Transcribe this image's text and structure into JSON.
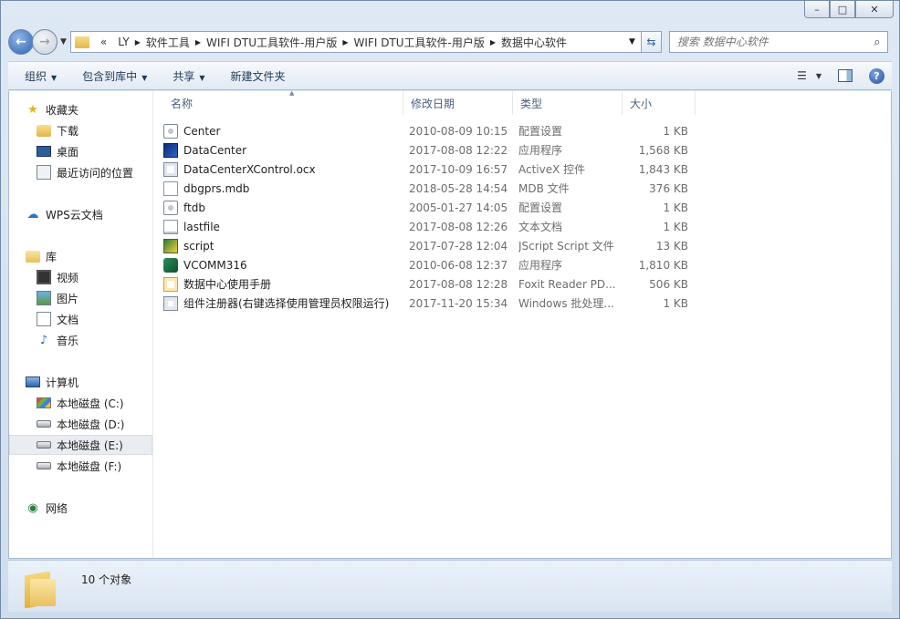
{
  "window": {
    "minimize_icon": "minimize-icon",
    "maximize_icon": "maximize-icon",
    "close_icon": "close-icon"
  },
  "address_bar": {
    "overflow": "«",
    "crumbs": [
      "LY",
      "软件工具",
      "WIFI DTU工具软件-用户版",
      "WIFI DTU工具软件-用户版",
      "数据中心软件"
    ]
  },
  "search": {
    "placeholder": "搜索 数据中心软件"
  },
  "toolbar": {
    "organize": "组织",
    "include_in_library": "包含到库中",
    "share": "共享",
    "new_folder": "新建文件夹"
  },
  "nav": {
    "favorites": "收藏夹",
    "downloads": "下载",
    "desktop": "桌面",
    "recent": "最近访问的位置",
    "wps_cloud": "WPS云文档",
    "libraries": "库",
    "videos": "视频",
    "pictures": "图片",
    "documents": "文档",
    "music": "音乐",
    "computer": "计算机",
    "drive_c": "本地磁盘 (C:)",
    "drive_d": "本地磁盘 (D:)",
    "drive_e": "本地磁盘 (E:)",
    "drive_f": "本地磁盘 (F:)",
    "network": "网络"
  },
  "columns": {
    "name": "名称",
    "date": "修改日期",
    "type": "类型",
    "size": "大小"
  },
  "files": [
    {
      "name": "Center",
      "date": "2010-08-09 10:15",
      "type": "配置设置",
      "size": "1 KB",
      "icon": "config-file-icon"
    },
    {
      "name": "DataCenter",
      "date": "2017-08-08 12:22",
      "type": "应用程序",
      "size": "1,568 KB",
      "icon": "application-icon"
    },
    {
      "name": "DataCenterXControl.ocx",
      "date": "2017-10-09 16:57",
      "type": "ActiveX 控件",
      "size": "1,843 KB",
      "icon": "activex-icon"
    },
    {
      "name": "dbgprs.mdb",
      "date": "2018-05-28 14:54",
      "type": "MDB 文件",
      "size": "376 KB",
      "icon": "mdb-file-icon"
    },
    {
      "name": "ftdb",
      "date": "2005-01-27 14:05",
      "type": "配置设置",
      "size": "1 KB",
      "icon": "config-file-icon"
    },
    {
      "name": "lastfile",
      "date": "2017-08-08 12:26",
      "type": "文本文档",
      "size": "1 KB",
      "icon": "text-file-icon"
    },
    {
      "name": "script",
      "date": "2017-07-28 12:04",
      "type": "JScript Script 文件",
      "size": "13 KB",
      "icon": "jscript-icon"
    },
    {
      "name": "VCOMM316",
      "date": "2010-06-08 12:37",
      "type": "应用程序",
      "size": "1,810 KB",
      "icon": "vcomm-app-icon"
    },
    {
      "name": "数据中心使用手册",
      "date": "2017-08-08 12:28",
      "type": "Foxit Reader PD...",
      "size": "506 KB",
      "icon": "pdf-icon"
    },
    {
      "name": "组件注册器(右键选择使用管理员权限运行)",
      "date": "2017-11-20 15:34",
      "type": "Windows 批处理...",
      "size": "1 KB",
      "icon": "batch-file-icon"
    }
  ],
  "status": {
    "count": "10 个对象"
  }
}
